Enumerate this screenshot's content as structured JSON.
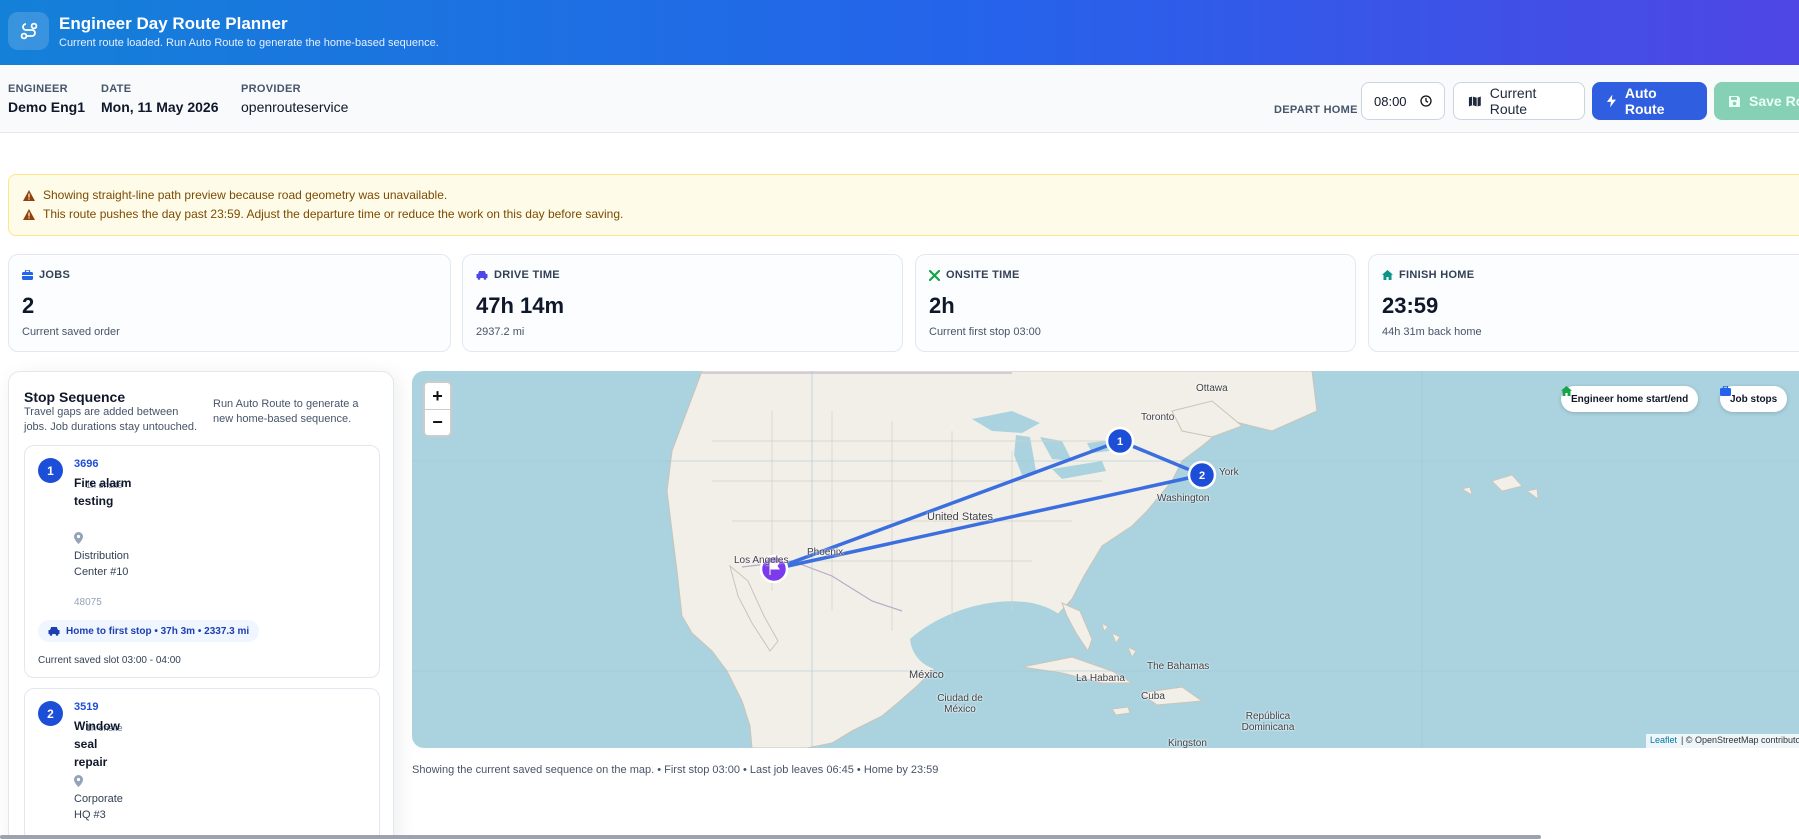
{
  "header": {
    "title": "Engineer Day Route Planner",
    "subtitle": "Current route loaded. Run Auto Route to generate the home-based sequence.",
    "icon": "route-icon"
  },
  "info": {
    "engineer_label": "ENGINEER",
    "engineer": "Demo Eng1",
    "date_label": "DATE",
    "date": "Mon, 11 May 2026",
    "provider_label": "PROVIDER",
    "provider": "openrouteservice",
    "depart_label": "DEPART HOME",
    "depart_time": "08:00"
  },
  "toolbar": {
    "current_route": "Current Route",
    "auto_route": "Auto Route",
    "save_route": "Save Rou"
  },
  "alerts": [
    "Showing straight-line path preview because road geometry was unavailable.",
    "This route pushes the day past 23:59. Adjust the departure time or reduce the work on this day before saving."
  ],
  "stats": [
    {
      "label": "JOBS",
      "value": "2",
      "sub": "Current saved order",
      "icon": "briefcase-icon",
      "color": "#2563eb"
    },
    {
      "label": "DRIVE TIME",
      "value": "47h 14m",
      "sub": "2937.2 mi",
      "icon": "car-icon",
      "color": "#4f46e5"
    },
    {
      "label": "ONSITE TIME",
      "value": "2h",
      "sub": "Current first stop 03:00",
      "icon": "tools-icon",
      "color": "#16a34a"
    },
    {
      "label": "FINISH HOME",
      "value": "23:59",
      "sub": "44h 31m back home",
      "icon": "home-icon",
      "color": "#0d9488"
    }
  ],
  "sidebar": {
    "title": "Stop Sequence",
    "description": "Travel gaps are added between jobs. Job durations stay untouched.",
    "hint": "Run Auto Route to generate a new home-based sequence.",
    "stops": [
      {
        "number": "1",
        "id": "3696",
        "name": "Fire alarm testing",
        "onsite": "1h onsite",
        "address": "Distribution Center #10",
        "zip": "48075",
        "drive": "Home to first stop • 37h 3m • 2337.3 mi",
        "slot": "Current saved slot 03:00 - 04:00"
      },
      {
        "number": "2",
        "id": "3519",
        "name": "Window seal repair",
        "onsite": "1h onsite",
        "address": "Corporate HQ #3"
      }
    ]
  },
  "map": {
    "zoom_in": "+",
    "zoom_out": "−",
    "legend": [
      "Engineer home start/end",
      "Job stops"
    ],
    "markers": [
      "1",
      "2"
    ],
    "labels": [
      "Ottawa",
      "Toronto",
      "York",
      "Washington",
      "United States",
      "Phoenix",
      "Los Angeles",
      "México",
      "Ciudad de México",
      "La Habana",
      "The Bahamas",
      "Cuba",
      "República Dominicana",
      "Kingston"
    ],
    "attribution_link": "Leaflet",
    "attribution": "| © OpenStreetMap contributors",
    "route_color": "#3b6fe0",
    "home_color": "#7c3aed",
    "stop_color": "#1d4ed8"
  },
  "footer": "Showing the current saved sequence on the map. • First stop 03:00 • Last job leaves 06:45 • Home by 23:59"
}
